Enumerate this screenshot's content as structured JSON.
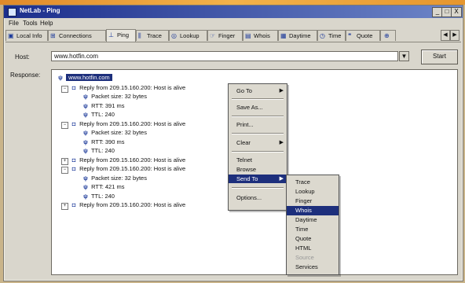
{
  "window": {
    "title": "NetLab - Ping",
    "controls": {
      "minimize": "_",
      "maximize": "□",
      "close": "X"
    }
  },
  "menu": [
    "File",
    "Tools",
    "Help"
  ],
  "tabs": [
    {
      "label": "Local Info",
      "icon": "computer-icon"
    },
    {
      "label": "Connections",
      "icon": "connections-icon"
    },
    {
      "label": "Ping",
      "icon": "ping-icon",
      "active": true
    },
    {
      "label": "Trace",
      "icon": "trace-icon"
    },
    {
      "label": "Lookup",
      "icon": "lookup-icon"
    },
    {
      "label": "Finger",
      "icon": "finger-icon"
    },
    {
      "label": "Whois",
      "icon": "whois-icon"
    },
    {
      "label": "Daytime",
      "icon": "daytime-icon"
    },
    {
      "label": "Time",
      "icon": "clock-icon"
    },
    {
      "label": "Quote",
      "icon": "quote-icon"
    }
  ],
  "tab_scroll": {
    "left": "◀",
    "right": "▶"
  },
  "form": {
    "host_label": "Host:",
    "host_value": "www.hotfin.com",
    "dropdown_glyph": "▼",
    "start_label": "Start",
    "response_label": "Response:"
  },
  "tree": {
    "root": "www.hotfin.com",
    "replies": [
      {
        "text": "Reply from 209.15.160.200: Host is alive",
        "expanded": true,
        "children": [
          "Packet size: 32 bytes",
          "RTT: 391 ms",
          "TTL: 240"
        ]
      },
      {
        "text": "Reply from 209.15.160.200: Host is alive",
        "expanded": true,
        "children": [
          "Packet size: 32 bytes",
          "RTT: 390 ms",
          "TTL: 240"
        ]
      },
      {
        "text": "Reply from 209.15.160.200: Host is alive",
        "expanded": false,
        "children": []
      },
      {
        "text": "Reply from 209.15.160.200: Host is alive",
        "expanded": true,
        "children": [
          "Packet size: 32 bytes",
          "RTT: 421 ms",
          "TTL: 240"
        ]
      },
      {
        "text": "Reply from 209.15.160.200: Host is alive",
        "expanded": false,
        "children": []
      }
    ]
  },
  "context_menu": {
    "items": [
      "Go To",
      "Save As...",
      "Print...",
      "Clear",
      "Telnet",
      "Browse",
      "Send To",
      "Options..."
    ],
    "submenu_arrow": "▶"
  },
  "send_to_menu": {
    "items": [
      "Trace",
      "Lookup",
      "Finger",
      "Whois",
      "Daytime",
      "Time",
      "Quote",
      "HTML",
      "Source",
      "Services"
    ],
    "highlighted": "Whois",
    "disabled": "Source"
  },
  "colors": {
    "title_gradient_start": "#1b2e8c",
    "title_gradient_end": "#6e86c8",
    "selection": "#1d2f7c",
    "face": "#d9d6cc"
  }
}
